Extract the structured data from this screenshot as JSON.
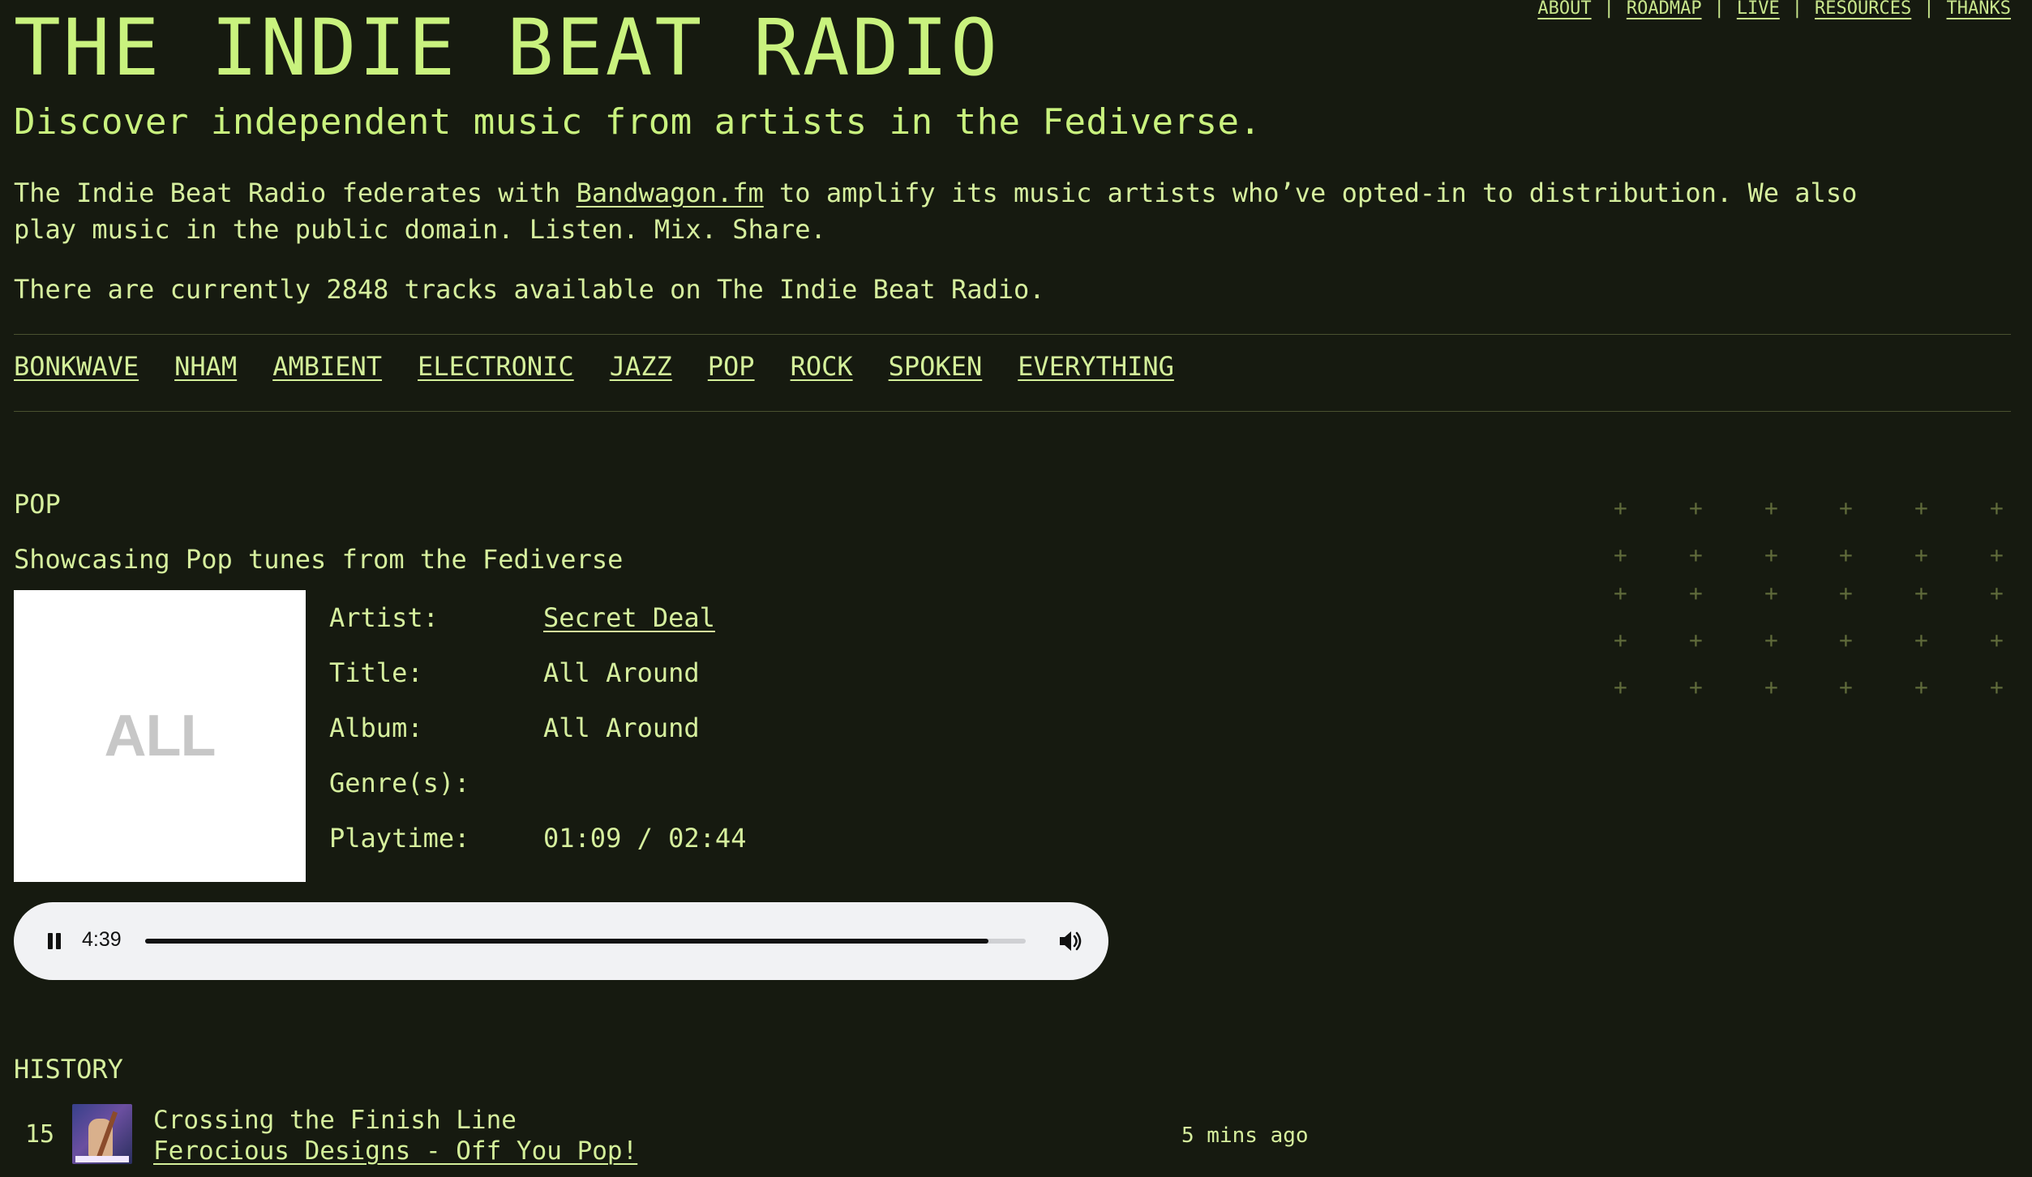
{
  "nav": {
    "items": [
      "ABOUT",
      "ROADMAP",
      "LIVE",
      "RESOURCES",
      "THANKS"
    ],
    "separator": "|"
  },
  "site": {
    "title": "THE INDIE BEAT RADIO",
    "tagline": "Discover independent music from artists in the Fediverse.",
    "intro_before": "The Indie Beat Radio federates with ",
    "intro_link": "Bandwagon.fm",
    "intro_after": " to amplify its music artists who’ve opted-in to distribution. We also play music in the public domain. Listen. Mix. Share.",
    "track_count_text": "There are currently 2848 tracks available on The Indie Beat Radio."
  },
  "genres": [
    "BONKWAVE",
    "NHAM",
    "AMBIENT",
    "ELECTRONIC",
    "JAZZ",
    "POP",
    "ROCK",
    "SPOKEN",
    "EVERYTHING"
  ],
  "station": {
    "title": "POP",
    "description": "Showcasing Pop tunes from the Fediverse"
  },
  "now_playing": {
    "cover_text": "ALL AROUND",
    "labels": {
      "artist": "Artist:",
      "title": "Title:",
      "album": "Album:",
      "genres": "Genre(s):",
      "playtime": "Playtime:"
    },
    "artist": "Secret Deal",
    "title": "All Around",
    "album": "All Around",
    "genres": "",
    "playtime": "01:09 / 02:44"
  },
  "player": {
    "time": "4:39",
    "progress_fraction": 0.958,
    "icons": {
      "pause": "pause-icon",
      "volume": "volume-icon"
    }
  },
  "history": {
    "title": "HISTORY",
    "items": [
      {
        "number": "15",
        "title": "Crossing the Finish Line",
        "subtitle": "Ferocious Designs - Off You Pop!",
        "time": "5 mins ago"
      }
    ]
  },
  "colors": {
    "background": "#161a10",
    "accent": "#c9f27e",
    "text": "#d6ef9e",
    "player_bg": "#f1f2f4"
  }
}
